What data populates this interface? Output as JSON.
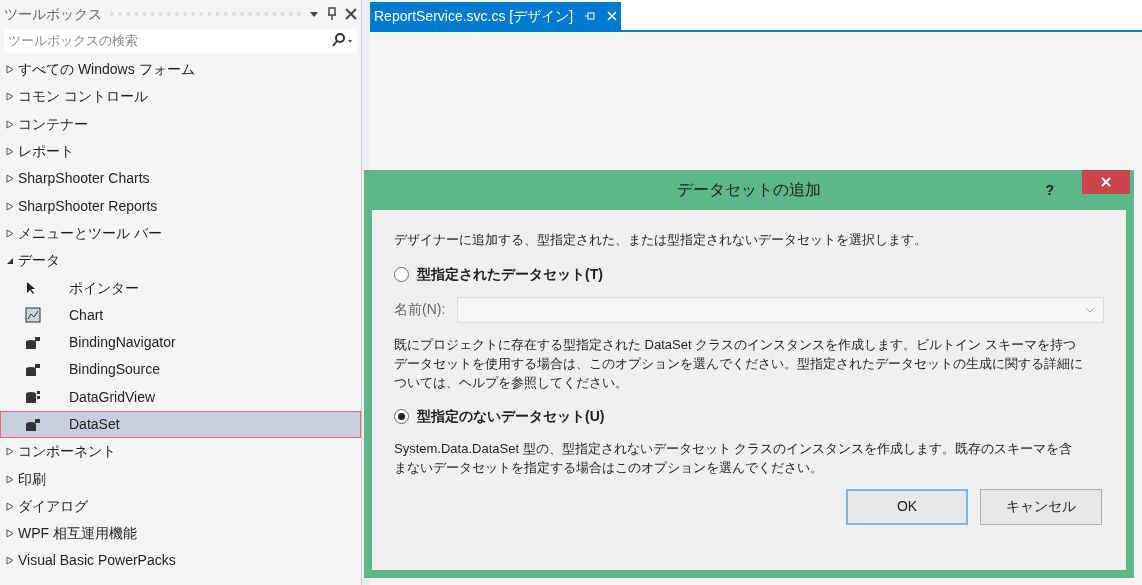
{
  "toolbox": {
    "title": "ツールボックス",
    "search_placeholder": "ツールボックスの検索",
    "items": [
      {
        "label": "すべての Windows フォーム",
        "expanded": false
      },
      {
        "label": "コモン コントロール",
        "expanded": false
      },
      {
        "label": "コンテナー",
        "expanded": false
      },
      {
        "label": "レポート",
        "expanded": false
      },
      {
        "label": "SharpShooter Charts",
        "expanded": false
      },
      {
        "label": "SharpShooter Reports",
        "expanded": false
      },
      {
        "label": "メニューとツール バー",
        "expanded": false
      },
      {
        "label": "データ",
        "expanded": true,
        "children": [
          {
            "label": "ポインター",
            "kind": "pointer",
            "selected": false
          },
          {
            "label": "Chart",
            "kind": "chart",
            "selected": false
          },
          {
            "label": "BindingNavigator",
            "kind": "database",
            "selected": false
          },
          {
            "label": "BindingSource",
            "kind": "database",
            "selected": false
          },
          {
            "label": "DataGridView",
            "kind": "grid",
            "selected": false
          },
          {
            "label": "DataSet",
            "kind": "database",
            "selected": true
          }
        ]
      },
      {
        "label": "コンポーネント",
        "expanded": false
      },
      {
        "label": "印刷",
        "expanded": false
      },
      {
        "label": "ダイアログ",
        "expanded": false
      },
      {
        "label": "WPF 相互運用機能",
        "expanded": false
      },
      {
        "label": "Visual Basic PowerPacks",
        "expanded": false
      }
    ]
  },
  "tab": {
    "label": "ReportService.svc.cs [デザイン]"
  },
  "dialog": {
    "title": "データセットの追加",
    "help": "?",
    "intro": "デザイナーに追加する、型指定された、または型指定されないデータセットを選択します。",
    "options": [
      {
        "label": "型指定されたデータセット(T)",
        "selected": false,
        "field_label": "名前(N):",
        "description": "既にプロジェクトに存在する型指定された DataSet クラスのインスタンスを作成します。ビルトイン スキーマを持つデータセットを使用する場合は、このオプションを選んでください。型指定されたデータセットの生成に関する詳細については、ヘルプを参照してください。"
      },
      {
        "label": "型指定のないデータセット(U)",
        "selected": true,
        "description": "System.Data.DataSet 型の、型指定されないデータセット クラスのインスタンスを作成します。既存のスキーマを含まないデータセットを指定する場合はこのオプションを選んでください。"
      }
    ],
    "buttons": [
      {
        "label": "OK",
        "default": true
      },
      {
        "label": "キャンセル",
        "default": false
      }
    ]
  }
}
